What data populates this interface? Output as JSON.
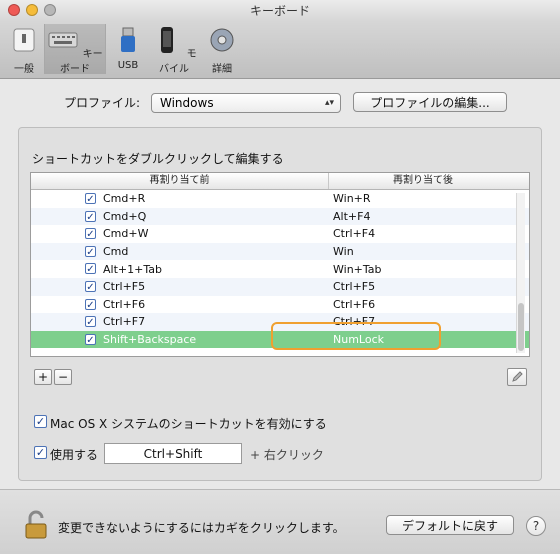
{
  "window": {
    "title": "キーボード"
  },
  "toolbar": {
    "items": [
      {
        "label": "一般",
        "icon": "switch-icon"
      },
      {
        "label": "キーボード",
        "icon": "keyboard-icon"
      },
      {
        "label": "USB",
        "icon": "usb-icon"
      },
      {
        "label": "モバイル",
        "icon": "iphone-icon"
      },
      {
        "label": "詳細",
        "icon": "gear-icon"
      }
    ]
  },
  "profile": {
    "label": "プロファイル:",
    "value": "Windows",
    "edit_button": "プロファイルの編集..."
  },
  "shortcuts": {
    "section_title": "ショートカットをダブルクリックして編集する",
    "col1": "再割り当て前",
    "col2": "再割り当て後",
    "rows": [
      {
        "before": "Cmd+R",
        "after": "Win+R"
      },
      {
        "before": "Cmd+Q",
        "after": "Alt+F4"
      },
      {
        "before": "Cmd+W",
        "after": "Ctrl+F4"
      },
      {
        "before": "Cmd",
        "after": "Win"
      },
      {
        "before": "Alt+1+Tab",
        "after": "Win+Tab"
      },
      {
        "before": "Ctrl+F5",
        "after": "Ctrl+F5"
      },
      {
        "before": "Ctrl+F6",
        "after": "Ctrl+F6"
      },
      {
        "before": "Ctrl+F7",
        "after": "Ctrl+F7"
      },
      {
        "before": "Shift+Backspace",
        "after": "NumLock"
      }
    ],
    "add_label": "+",
    "remove_label": "−"
  },
  "options": {
    "macos_shortcuts": "Mac OS X システムのショートカットを有効にする",
    "use_label": "使用する",
    "modifier_value": "Ctrl+Shift",
    "right_click_label": "+ 右クリック"
  },
  "footer": {
    "lock_text": "変更できないようにするにはカギをクリックします。",
    "default_button": "デフォルトに戻す",
    "help_label": "?"
  }
}
